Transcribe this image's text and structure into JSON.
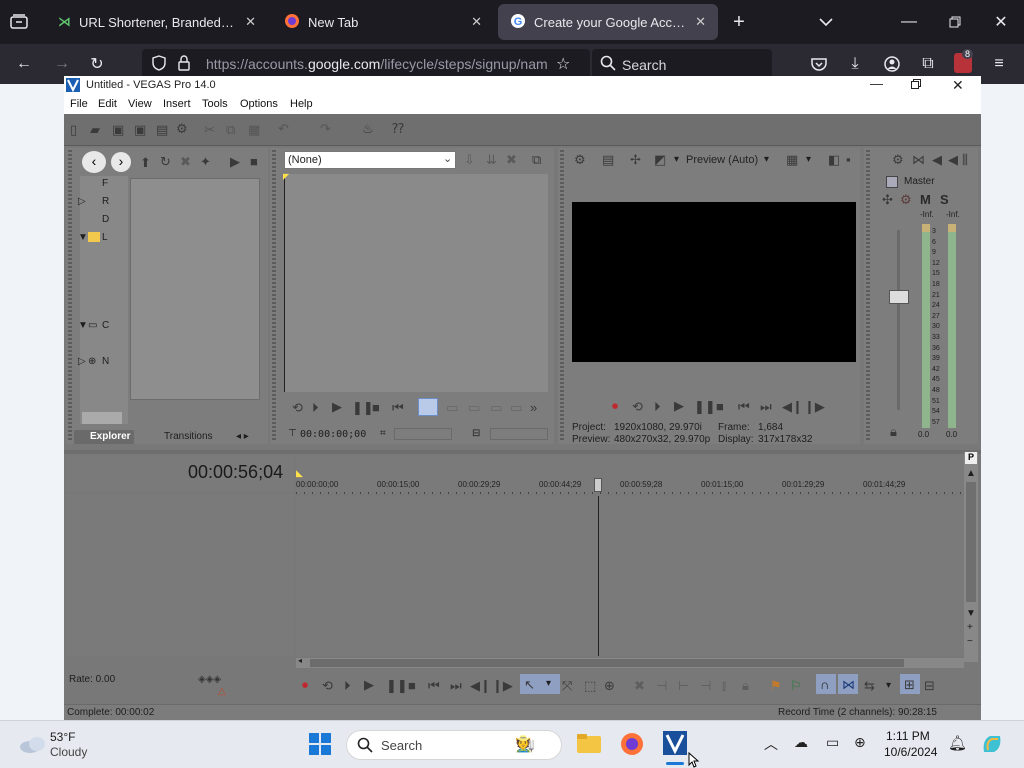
{
  "browser": {
    "tabs": [
      {
        "label": "URL Shortener, Branded Short L"
      },
      {
        "label": "New Tab"
      },
      {
        "label": "Create your Google Account"
      }
    ],
    "url_prefix": "https://accounts.",
    "url_domain": "google.com",
    "url_suffix": "/lifecycle/steps/signup/nam",
    "search_placeholder": "Search",
    "extension_badge": "8"
  },
  "vegas": {
    "title": "Untitled - VEGAS Pro 14.0",
    "menu": [
      "File",
      "Edit",
      "View",
      "Insert",
      "Tools",
      "Options",
      "Help"
    ],
    "trimmer_dropdown": "(None)",
    "trimmer_time": "00:00:00;00",
    "preview_mode": "Preview (Auto)",
    "explorer_tabs": [
      "Explorer",
      "Transitions"
    ],
    "tree_items": [
      "F",
      "R",
      "D",
      "L",
      "C",
      "N"
    ],
    "project_label": "Project:",
    "project_value": "1920x1080, 29.970i",
    "preview_label": "Preview:",
    "preview_value": "480x270x32, 29.970p",
    "frame_label": "Frame:",
    "frame_value": "1,684",
    "display_label": "Display:",
    "display_value": "317x178x32",
    "mixer_title": "Master",
    "mixer_m": "M",
    "mixer_s": "S",
    "mixer_inf_left": "-Inf.",
    "mixer_inf_right": "-Inf.",
    "meter_scale": [
      "3",
      "6",
      "9",
      "12",
      "15",
      "18",
      "21",
      "24",
      "27",
      "30",
      "33",
      "36",
      "39",
      "42",
      "45",
      "48",
      "51",
      "54",
      "57"
    ],
    "mixer_bottom_left": "0.0",
    "mixer_bottom_right": "0.0",
    "timecode": "00:00:56;04",
    "ruler": [
      "00:00:00;00",
      "00:00:15;00",
      "00:00:29;29",
      "00:00:44;29",
      "00:00:59;28",
      "00:01:15;00",
      "00:01:29;29",
      "00:01:44;29"
    ],
    "rate": "Rate: 0.00",
    "status_left": "Complete: 00:00:02",
    "status_right": "Record Time (2 channels): 90:28:15"
  },
  "taskbar": {
    "weather_temp": "53°F",
    "weather_desc": "Cloudy",
    "search_placeholder": "Search",
    "time": "1:11 PM",
    "date": "10/6/2024"
  }
}
